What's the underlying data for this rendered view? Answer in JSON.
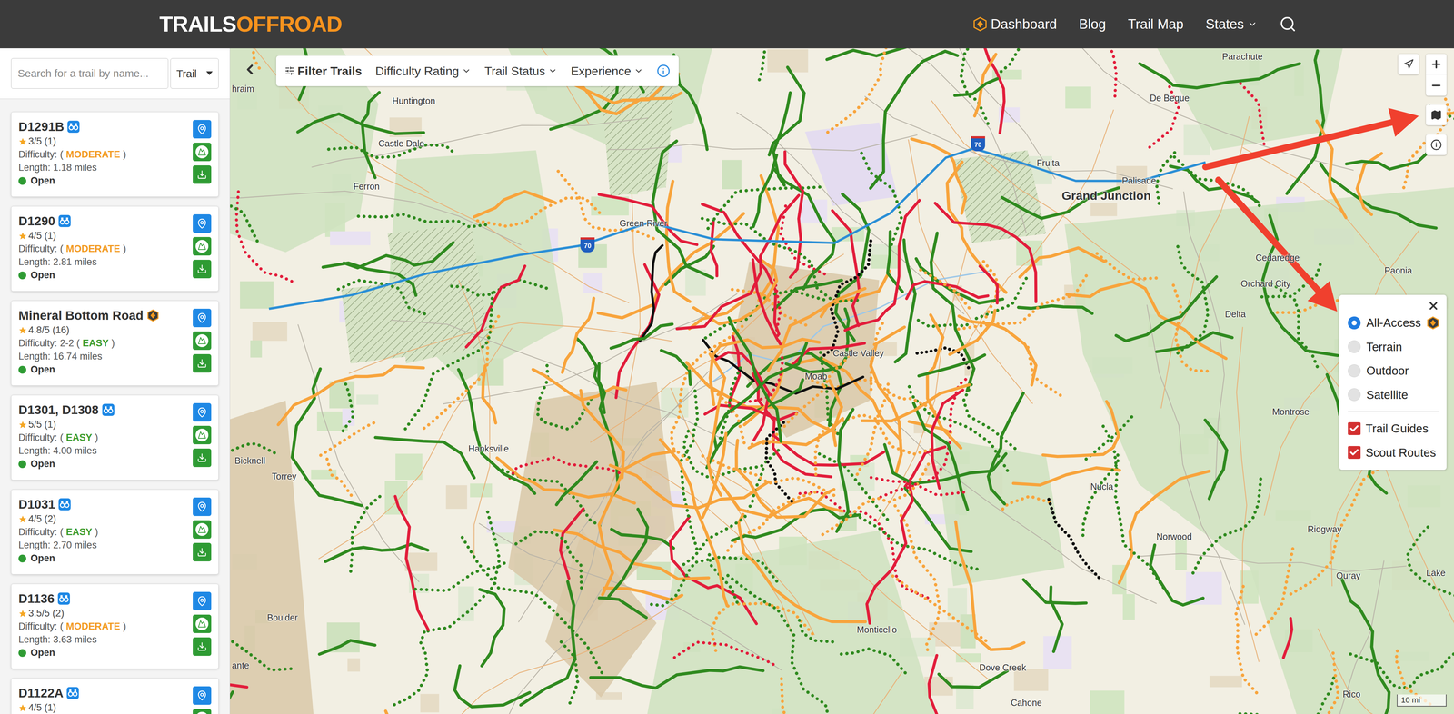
{
  "header": {
    "logo": {
      "part1": "TRAILS",
      "part2": "OFFROAD"
    },
    "nav": [
      {
        "label": "Dashboard",
        "kind": "badge"
      },
      {
        "label": "Blog",
        "kind": "link"
      },
      {
        "label": "Trail Map",
        "kind": "link"
      },
      {
        "label": "States",
        "kind": "dropdown"
      }
    ]
  },
  "sidebar": {
    "search": {
      "placeholder": "Search for a trail by name..."
    },
    "type_select": {
      "value": "Trail"
    },
    "trails": [
      {
        "name": "D1291B",
        "kind": "scout",
        "rating": "3/5 (1)",
        "difficulty": {
          "label": "Difficulty:",
          "prefix": "(",
          "value": "MODERATE",
          "suffix": ")",
          "color": "#f39a1e"
        },
        "length": "Length: 1.18 miles",
        "status": {
          "label": "Open",
          "color": "#2e9b33"
        }
      },
      {
        "name": "D1290",
        "kind": "scout",
        "rating": "4/5 (1)",
        "difficulty": {
          "label": "Difficulty:",
          "prefix": "(",
          "value": "MODERATE",
          "suffix": ")",
          "color": "#f39a1e"
        },
        "length": "Length: 2.81 miles",
        "status": {
          "label": "Open",
          "color": "#2e9b33"
        }
      },
      {
        "name": "Mineral Bottom Road",
        "kind": "guide",
        "rating": "4.8/5 (16)",
        "difficulty": {
          "label": "Difficulty:",
          "prefix": "2-2 (",
          "value": "EASY",
          "suffix": ")",
          "color": "#3a9b2c"
        },
        "length": "Length: 16.74 miles",
        "status": {
          "label": "Open",
          "color": "#2e9b33"
        }
      },
      {
        "name": "D1301, D1308",
        "kind": "scout",
        "rating": "5/5 (1)",
        "difficulty": {
          "label": "Difficulty:",
          "prefix": "(",
          "value": "EASY",
          "suffix": ")",
          "color": "#3a9b2c"
        },
        "length": "Length: 4.00 miles",
        "status": {
          "label": "Open",
          "color": "#2e9b33"
        }
      },
      {
        "name": "D1031",
        "kind": "scout",
        "rating": "4/5 (2)",
        "difficulty": {
          "label": "Difficulty:",
          "prefix": "(",
          "value": "EASY",
          "suffix": ")",
          "color": "#3a9b2c"
        },
        "length": "Length: 2.70 miles",
        "status": {
          "label": "Open",
          "color": "#2e9b33"
        }
      },
      {
        "name": "D1136",
        "kind": "scout",
        "rating": "3.5/5 (2)",
        "difficulty": {
          "label": "Difficulty:",
          "prefix": "(",
          "value": "MODERATE",
          "suffix": ")",
          "color": "#f39a1e"
        },
        "length": "Length: 3.63 miles",
        "status": {
          "label": "Open",
          "color": "#2e9b33"
        }
      },
      {
        "name": "D1122A",
        "kind": "scout",
        "rating": "4/5 (1)"
      }
    ]
  },
  "filters": [
    {
      "label": "Filter Trails",
      "kind": "filter"
    },
    {
      "label": "Difficulty Rating",
      "kind": "dropdown"
    },
    {
      "label": "Trail Status",
      "kind": "dropdown"
    },
    {
      "label": "Experience",
      "kind": "dropdown"
    }
  ],
  "layers": {
    "base": [
      {
        "label": "All-Access",
        "selected": true,
        "badge": true
      },
      {
        "label": "Terrain",
        "selected": false,
        "badge": false
      },
      {
        "label": "Outdoor",
        "selected": false,
        "badge": false
      },
      {
        "label": "Satellite",
        "selected": false,
        "badge": false
      }
    ],
    "overlays": [
      {
        "label": "Trail Guides",
        "checked": true
      },
      {
        "label": "Scout Routes",
        "checked": true
      }
    ]
  },
  "map": {
    "labels": [
      {
        "text": "hraim",
        "kind": "town"
      },
      {
        "text": "Huntington",
        "kind": "town"
      },
      {
        "text": "Castle Dale",
        "kind": "town"
      },
      {
        "text": "Ferron",
        "kind": "town"
      },
      {
        "text": "Green River",
        "kind": "town"
      },
      {
        "text": "De Beque",
        "kind": "town"
      },
      {
        "text": "Parachute",
        "kind": "town"
      },
      {
        "text": "Fruita",
        "kind": "town"
      },
      {
        "text": "Palisade",
        "kind": "town"
      },
      {
        "text": "Grand Junction",
        "kind": "city"
      },
      {
        "text": "Cedaredge",
        "kind": "town"
      },
      {
        "text": "Paonia",
        "kind": "town"
      },
      {
        "text": "Orchard City",
        "kind": "town"
      },
      {
        "text": "Delta",
        "kind": "town"
      },
      {
        "text": "Castle Valley",
        "kind": "town"
      },
      {
        "text": "Moab",
        "kind": "town"
      },
      {
        "text": "Hanksville",
        "kind": "town"
      },
      {
        "text": "Bicknell",
        "kind": "town"
      },
      {
        "text": "Torrey",
        "kind": "town"
      },
      {
        "text": "Montrose",
        "kind": "town"
      },
      {
        "text": "Nucla",
        "kind": "town"
      },
      {
        "text": "Norwood",
        "kind": "town"
      },
      {
        "text": "Ridgway",
        "kind": "town"
      },
      {
        "text": "Ouray",
        "kind": "town"
      },
      {
        "text": "Lake",
        "kind": "town"
      },
      {
        "text": "Boulder",
        "kind": "town"
      },
      {
        "text": "Monticello",
        "kind": "town"
      },
      {
        "text": "Dove Creek",
        "kind": "town"
      },
      {
        "text": "Rico",
        "kind": "town"
      },
      {
        "text": "Cahone",
        "kind": "town"
      },
      {
        "text": "ante",
        "kind": "town"
      }
    ],
    "shields": [
      {
        "label": "70"
      },
      {
        "label": "70"
      }
    ],
    "scale": "10 mi"
  }
}
